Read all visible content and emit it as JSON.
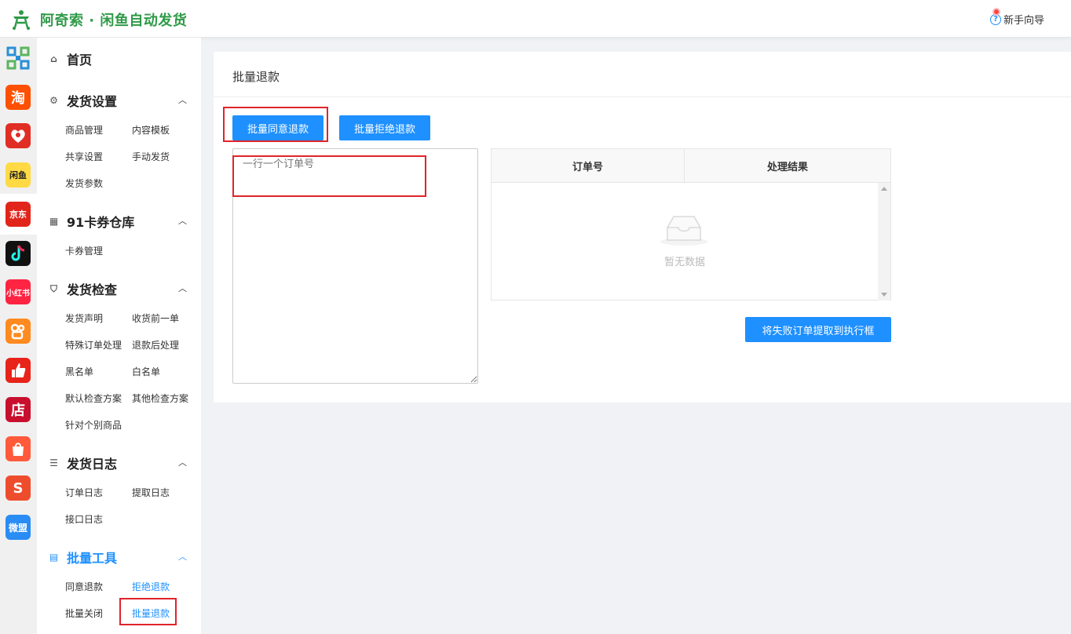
{
  "header": {
    "brand": "阿奇索 · 闲鱼自动发货",
    "guide_label": "新手向导",
    "brand_color": "#2f9a48"
  },
  "rail": {
    "items": [
      {
        "name": "grid-icon",
        "label": "",
        "color": "#2a8fd6"
      },
      {
        "name": "taobao-icon",
        "label": "淘",
        "color": "#ff5000"
      },
      {
        "name": "pinduoduo-icon",
        "label": "",
        "color": "#e02e24"
      },
      {
        "name": "xianyu-icon",
        "label": "闲鱼",
        "color": "#ffda44"
      },
      {
        "name": "jd-icon",
        "label": "京东",
        "color": "#e1251b"
      },
      {
        "name": "douyin-icon",
        "label": "",
        "color": "#111111"
      },
      {
        "name": "xiaohongshu-icon",
        "label": "小红书",
        "color": "#ff2442"
      },
      {
        "name": "kuaishou-icon",
        "label": "",
        "color": "#ff8a1f"
      },
      {
        "name": "thumb-icon",
        "label": "",
        "color": "#e8231a"
      },
      {
        "name": "dian-icon",
        "label": "店",
        "color": "#c8102e"
      },
      {
        "name": "shop-bag-icon",
        "label": "",
        "color": "#ff5a3c"
      },
      {
        "name": "shopee-icon",
        "label": "S",
        "color": "#ee4d2d"
      },
      {
        "name": "weimeng-icon",
        "label": "微盟",
        "color": "#2a8cf5"
      }
    ]
  },
  "menu": {
    "home": "首页",
    "sections": [
      {
        "title": "发货设置",
        "items": [
          "商品管理",
          "内容模板",
          "共享设置",
          "手动发货",
          "发货参数"
        ]
      },
      {
        "title": "91卡券仓库",
        "items": [
          "卡券管理"
        ]
      },
      {
        "title": "发货检查",
        "items": [
          "发货声明",
          "收货前一单",
          "特殊订单处理",
          "退款后处理",
          "黑名单",
          "白名单",
          "默认检查方案",
          "其他检查方案",
          "针对个别商品"
        ]
      },
      {
        "title": "发货日志",
        "items": [
          "订单日志",
          "提取日志",
          "接口日志"
        ]
      },
      {
        "title": "批量工具",
        "items": [
          "同意退款",
          "拒绝退款",
          "批量关闭",
          "批量退款"
        ]
      }
    ]
  },
  "main": {
    "title": "批量退款",
    "btn_agree": "批量同意退款",
    "btn_reject": "批量拒绝退款",
    "textarea_placeholder": "一行一个订单号",
    "table": {
      "columns": [
        "订单号",
        "处理结果"
      ],
      "empty_text": "暂无数据"
    },
    "btn_extract": "将失败订单提取到执行框"
  },
  "colors": {
    "accent": "#1e90ff",
    "highlight_box": "#e0242b"
  }
}
